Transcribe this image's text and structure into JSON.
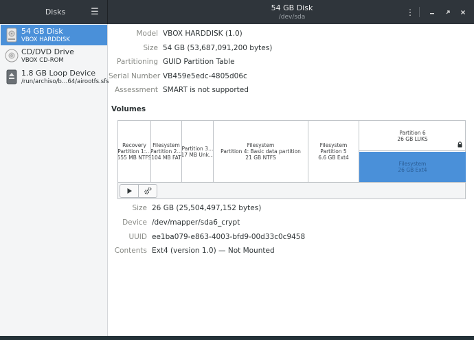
{
  "sidebar": {
    "title": "Disks",
    "drives": [
      {
        "name": "54 GB Disk",
        "sub": "VBOX HARDDISK",
        "icon": "hard-disk-icon"
      },
      {
        "name": "CD/DVD Drive",
        "sub": "VBOX CD-ROM",
        "icon": "optical-disc-icon"
      },
      {
        "name": "1.8 GB Loop Device",
        "sub": "/run/archiso/b…64/airootfs.sfs",
        "icon": "loop-device-icon"
      }
    ]
  },
  "header": {
    "title": "54 GB Disk",
    "subtitle": "/dev/sda"
  },
  "disk": {
    "model_label": "Model",
    "model": "VBOX HARDDISK (1.0)",
    "size_label": "Size",
    "size": "54 GB (53,687,091,200 bytes)",
    "partitioning_label": "Partitioning",
    "partitioning": "GUID Partition Table",
    "serial_label": "Serial Number",
    "serial": "VB459e5edc-4805d06c",
    "assessment_label": "Assessment",
    "assessment": "SMART is not supported"
  },
  "volumes": {
    "heading": "Volumes",
    "partitions": [
      {
        "line1": "Recovery",
        "line2": "Partition 1:…",
        "line3": "555 MB NTFS"
      },
      {
        "line1": "Filesystem",
        "line2": "Partition 2…",
        "line3": "104 MB FAT"
      },
      {
        "line1": "Partition 3…",
        "line2": "17 MB Unk…"
      },
      {
        "line1": "Filesystem",
        "line2": "Partition 4: Basic data partition",
        "line3": "21 GB NTFS"
      },
      {
        "line1": "Filesystem",
        "line2": "Partition 5",
        "line3": "6.6 GB Ext4"
      }
    ],
    "partition6": {
      "line1": "Partition 6",
      "line2": "26 GB LUKS"
    },
    "selected": {
      "line1": "Filesystem",
      "line2": "26 GB Ext4"
    }
  },
  "selected_volume": {
    "size_label": "Size",
    "size": "26 GB (25,504,497,152 bytes)",
    "device_label": "Device",
    "device": "/dev/mapper/sda6_crypt",
    "uuid_label": "UUID",
    "uuid": "ee1ba079-e863-4003-bfd9-00d33c0c9458",
    "contents_label": "Contents",
    "contents": "Ext4 (version 1.0) — Not Mounted"
  },
  "colors": {
    "accent": "#4a90d9",
    "headerbar": "#2f353b"
  }
}
